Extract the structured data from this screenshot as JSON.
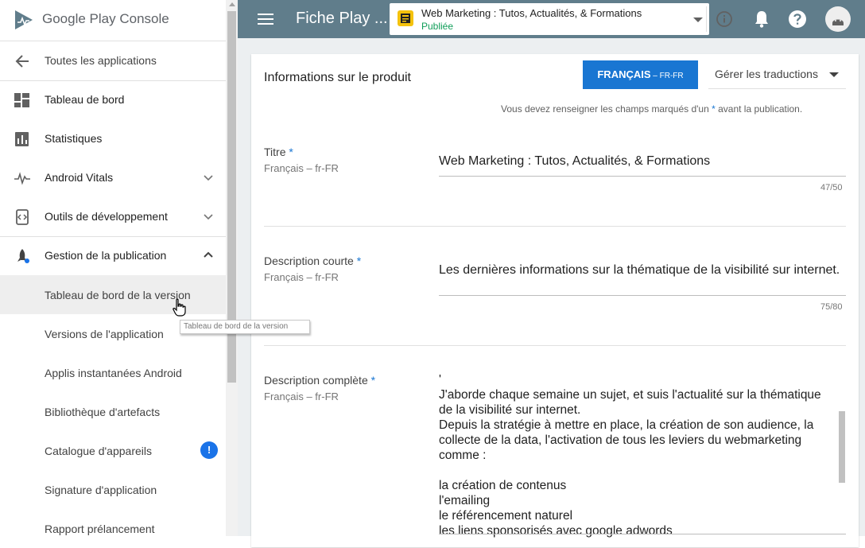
{
  "logo": {
    "google": "Google Play",
    "console": " Console"
  },
  "sidebar": {
    "back": "Toutes les applications",
    "items": [
      {
        "label": "Tableau de bord",
        "icon": "dashboard-icon"
      },
      {
        "label": "Statistiques",
        "icon": "bar-chart-icon"
      },
      {
        "label": "Android Vitals",
        "icon": "vitals-icon"
      },
      {
        "label": "Outils de développement",
        "icon": "dev-tools-icon"
      },
      {
        "label": "Gestion de la publication",
        "icon": "rocket-icon"
      }
    ],
    "sub_items": [
      {
        "label": "Tableau de bord de la version"
      },
      {
        "label": "Versions de l'application"
      },
      {
        "label": "Applis instantanées Android"
      },
      {
        "label": "Bibliothèque d'artefacts"
      },
      {
        "label": "Catalogue d'appareils",
        "badge": "!"
      },
      {
        "label": "Signature d'application"
      },
      {
        "label": "Rapport prélancement"
      }
    ],
    "tooltip": "Tableau de bord de la version"
  },
  "topbar": {
    "title": "Fiche Play ...",
    "app_name": "Web Marketing : Tutos, Actualités, & Formations",
    "app_status": "Publiée"
  },
  "card": {
    "title": "Informations sur le produit",
    "lang_button": "FRANÇAIS",
    "lang_code": " – FR-FR",
    "translations": "Gérer les traductions",
    "required_note_a": "Vous devez renseigner les champs marqués d'un ",
    "required_note_b": " avant la publication.",
    "star": "*"
  },
  "fields": {
    "title": {
      "label": "Titre",
      "sub": "Français – fr-FR",
      "value": "Web Marketing : Tutos, Actualités, & Formations",
      "counter": "47/50"
    },
    "short_desc": {
      "label": "Description courte",
      "sub": "Français – fr-FR",
      "value": "Les dernières informations sur la thématique de la visibilité sur internet.",
      "counter": "75/80"
    },
    "full_desc": {
      "label": "Description complète",
      "sub": "Français – fr-FR",
      "lines": [
        "'",
        "J'aborde chaque semaine un sujet, et suis l'actualité sur la thématique",
        "de la visibilité sur internet.",
        "Depuis la stratégie à mettre en place, la création de son audience, la",
        "collecte de la data, l'activation de tous les leviers du webmarketing",
        "comme :",
        "",
        "la création de contenus",
        "l'emailing",
        "le référencement naturel",
        "les liens sponsorisés avec google adwords"
      ]
    }
  },
  "colors": {
    "topbar": "#607d8b",
    "accent": "#1976d2",
    "published": "#0f9d58",
    "content_bg": "#eceff1"
  }
}
